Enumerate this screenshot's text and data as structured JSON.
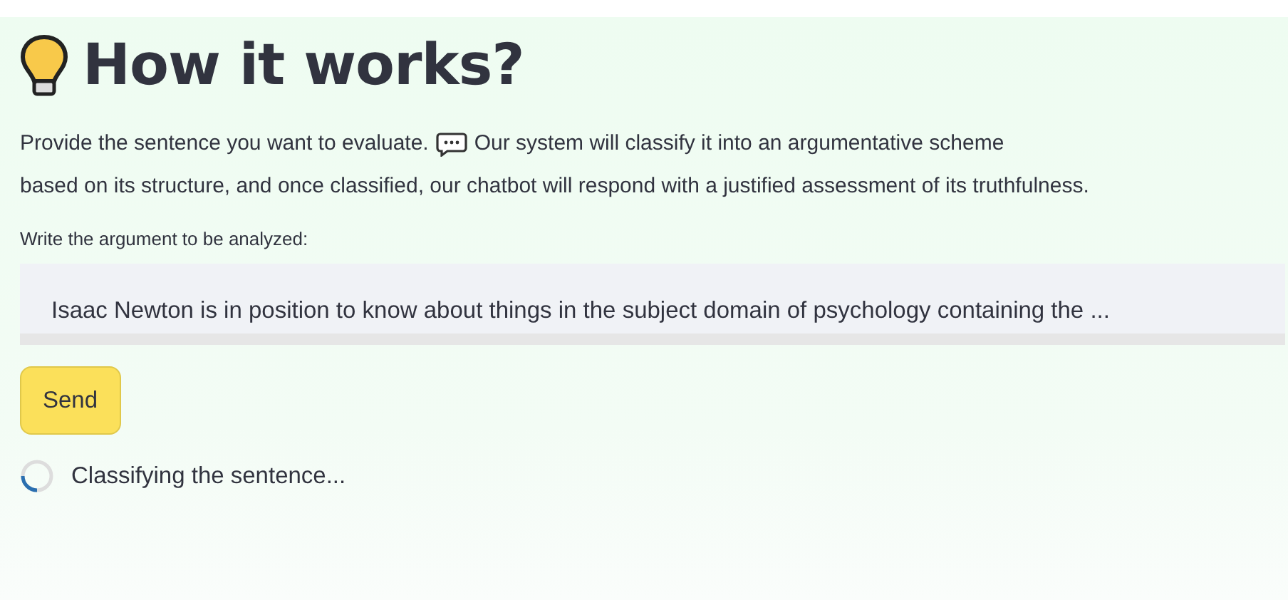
{
  "header": {
    "title": "How it works?"
  },
  "description": {
    "before_icon": "Provide the sentence you want to evaluate.",
    "after_icon": "Our system will classify it into an argumentative scheme",
    "continuation": "based on its structure, and once classified, our chatbot will respond with a justified assessment of its truthfulness."
  },
  "argument_field": {
    "label": "Write the argument to be analyzed:",
    "value": "Isaac Newton is in position to know about things in the subject domain of psychology containing the ..."
  },
  "send_button": {
    "label": "Send"
  },
  "status": {
    "text": "Classifying the sentence..."
  }
}
